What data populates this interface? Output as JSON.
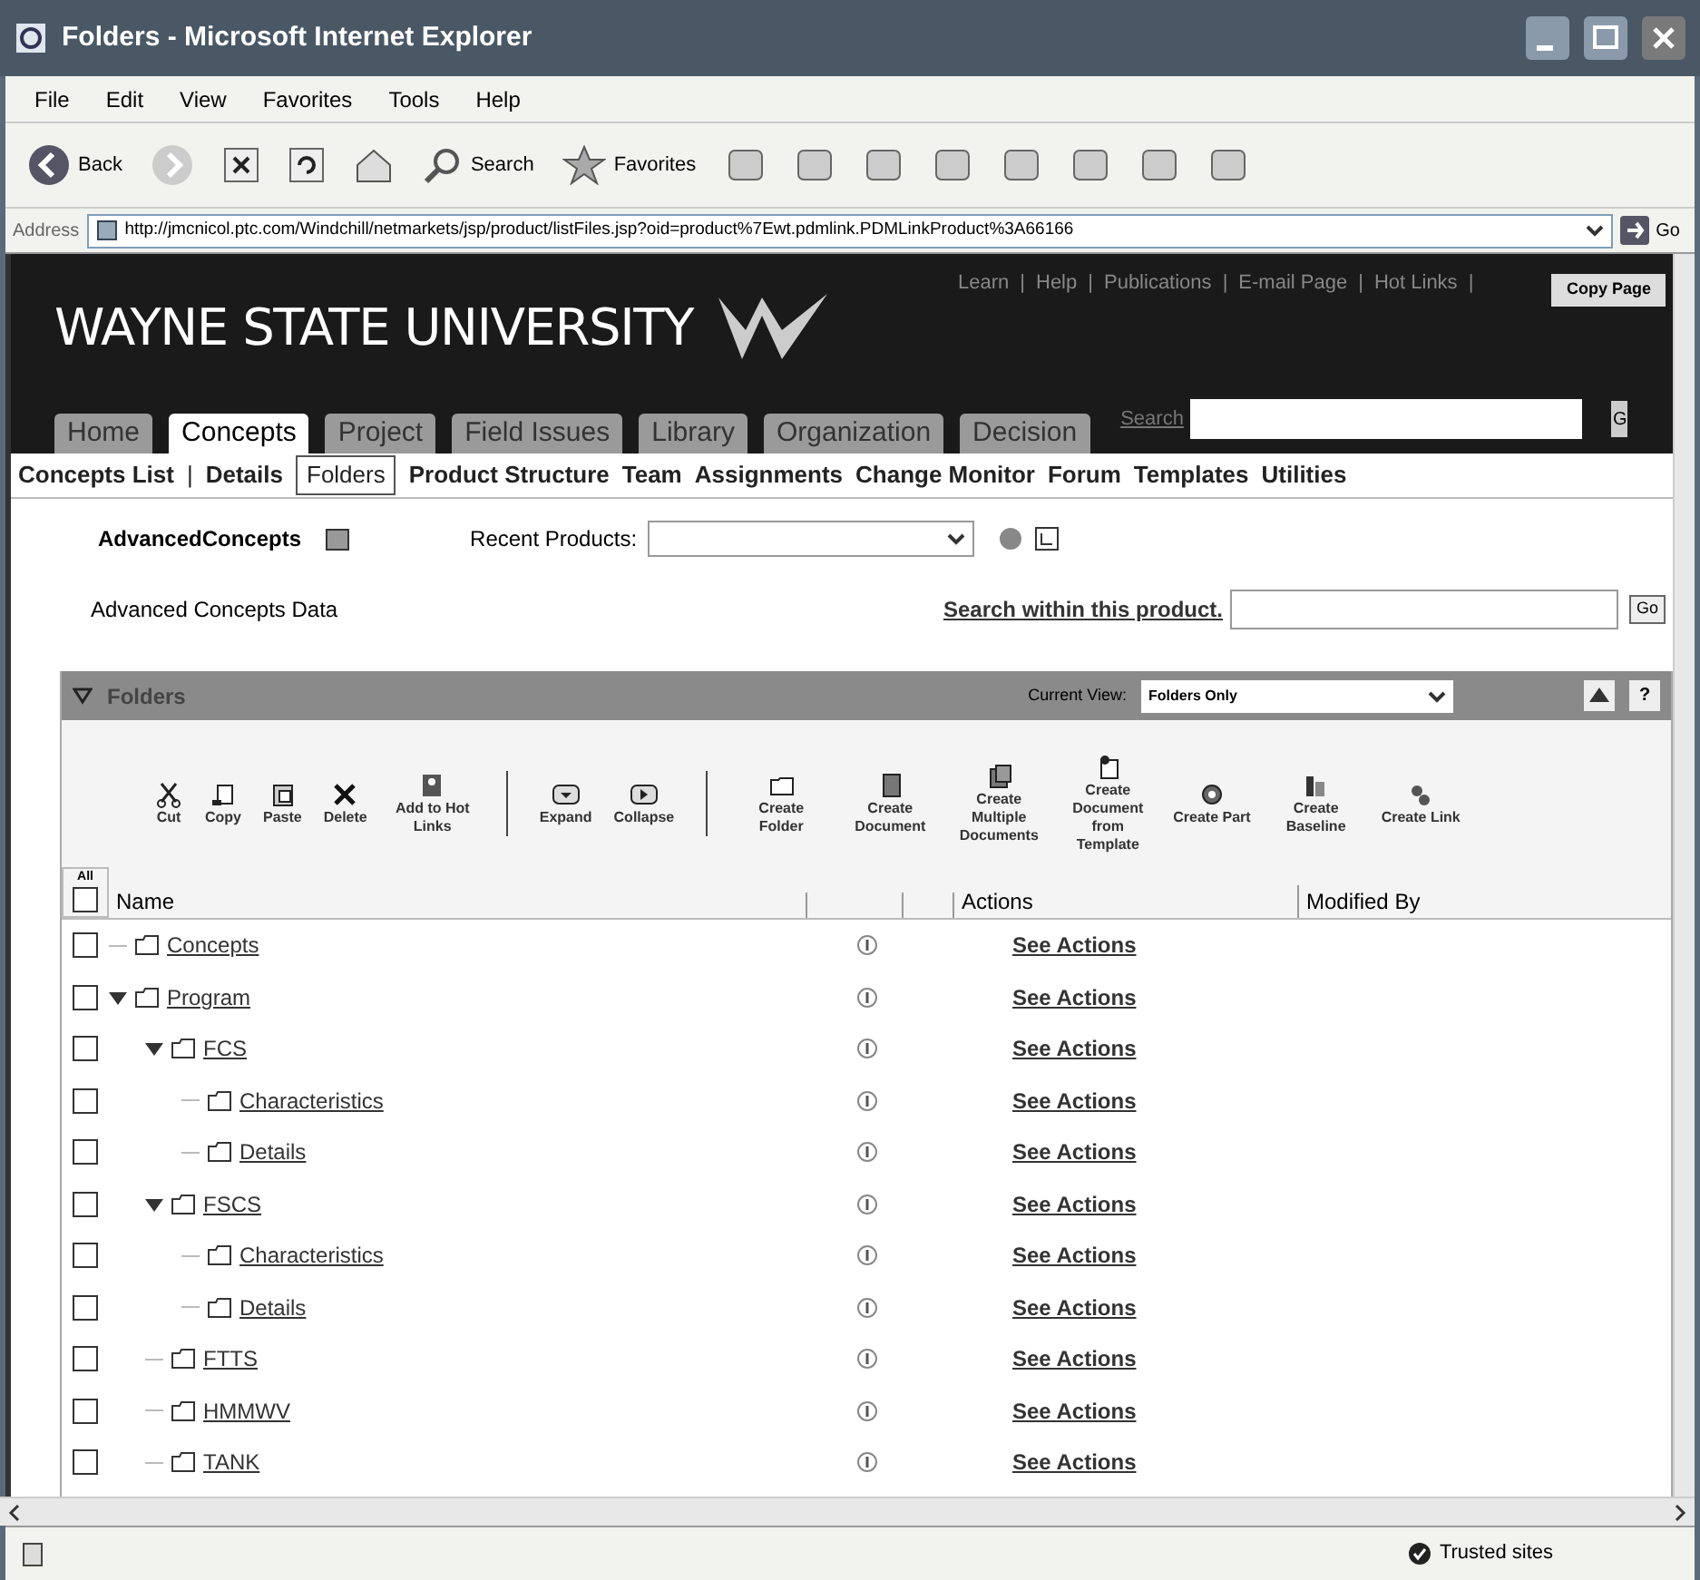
{
  "window": {
    "title": "Folders - Microsoft Internet Explorer"
  },
  "menu": [
    "File",
    "Edit",
    "View",
    "Favorites",
    "Tools",
    "Help"
  ],
  "toolbar": {
    "back": "Back",
    "search": "Search",
    "favorites": "Favorites"
  },
  "address": {
    "label": "Address",
    "url": "http://jmcnicol.ptc.com/Windchill/netmarkets/jsp/product/listFiles.jsp?oid=product%7Ewt.pdmlink.PDMLinkProduct%3A66166",
    "go": "Go"
  },
  "header": {
    "logo": "WAYNE STATE UNIVERSITY",
    "links": [
      "Learn",
      "Help",
      "Publications",
      "E-mail Page",
      "Hot Links"
    ],
    "separator": "|",
    "copy_button": "Copy Page",
    "search_label": "Search",
    "search_button": "G"
  },
  "tabs": [
    {
      "label": "Home",
      "selected": false
    },
    {
      "label": "Concepts",
      "selected": true
    },
    {
      "label": "Project",
      "selected": false
    },
    {
      "label": "Field Issues",
      "selected": false
    },
    {
      "label": "Library",
      "selected": false
    },
    {
      "label": "Organization",
      "selected": false
    },
    {
      "label": "Decision",
      "selected": false
    }
  ],
  "subnav": {
    "separator": "|",
    "items": [
      {
        "label": "Concepts List",
        "selected": false
      },
      {
        "label": "Details",
        "selected": false
      },
      {
        "label": "Folders",
        "selected": true
      },
      {
        "label": "Product Structure",
        "selected": false
      },
      {
        "label": "Team",
        "selected": false
      },
      {
        "label": "Assignments",
        "selected": false
      },
      {
        "label": "Change Monitor",
        "selected": false
      },
      {
        "label": "Forum",
        "selected": false
      },
      {
        "label": "Templates",
        "selected": false
      },
      {
        "label": "Utilities",
        "selected": false
      }
    ]
  },
  "product": {
    "name": "AdvancedConcepts",
    "recent_label": "Recent Products:",
    "context": "Advanced Concepts Data",
    "search_link": "Search within this product.",
    "go": "Go"
  },
  "panel": {
    "title": "Folders",
    "expanded": true,
    "view_label": "Current View:",
    "view_value": "Folders Only",
    "help": "?",
    "action_groups": [
      [
        {
          "label": "Cut",
          "kind": "cut"
        },
        {
          "label": "Copy",
          "kind": "copy"
        },
        {
          "label": "Paste",
          "kind": "paste"
        },
        {
          "label": "Delete",
          "kind": "delete"
        },
        {
          "label": "Add to Hot Links",
          "kind": "hotlink"
        }
      ],
      [
        {
          "label": "Expand",
          "kind": "expand"
        },
        {
          "label": "Collapse",
          "kind": "collapse"
        }
      ],
      [
        {
          "label": "Create Folder",
          "kind": "folder"
        },
        {
          "label": "Create Document",
          "kind": "document"
        },
        {
          "label": "Create Multiple Documents",
          "kind": "documents"
        },
        {
          "label": "Create Document from Template",
          "kind": "template"
        },
        {
          "label": "Create Part",
          "kind": "part"
        },
        {
          "label": "Create Baseline",
          "kind": "baseline"
        },
        {
          "label": "Create Link",
          "kind": "link"
        }
      ]
    ]
  },
  "table": {
    "select_all": "All",
    "all_checked": false,
    "columns": [
      "Name",
      "Actions",
      "Modified By"
    ],
    "rows": [
      {
        "name": "Concepts",
        "action": "See Actions",
        "checked": false
      },
      {
        "name": "Program",
        "action": "See Actions",
        "checked": false,
        "expanded": true,
        "children": [
          {
            "name": "FCS",
            "action": "See Actions",
            "checked": false,
            "expanded": true,
            "children": [
              {
                "name": "Characteristics",
                "action": "See Actions",
                "checked": false
              },
              {
                "name": "Details",
                "action": "See Actions",
                "checked": false
              }
            ]
          },
          {
            "name": "FSCS",
            "action": "See Actions",
            "checked": false,
            "expanded": true,
            "children": [
              {
                "name": "Characteristics",
                "action": "See Actions",
                "checked": false
              },
              {
                "name": "Details",
                "action": "See Actions",
                "checked": false
              }
            ]
          },
          {
            "name": "FTTS",
            "action": "See Actions",
            "checked": false
          },
          {
            "name": "HMMWV",
            "action": "See Actions",
            "checked": false
          },
          {
            "name": "TANK",
            "action": "See Actions",
            "checked": false
          }
        ]
      }
    ]
  },
  "status_bar": {
    "zone": "Trusted sites"
  }
}
